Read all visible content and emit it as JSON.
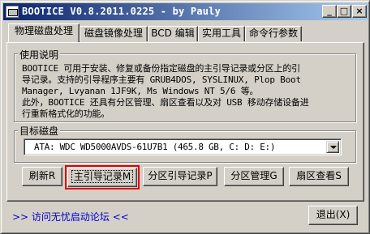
{
  "window": {
    "title": "BOOTICE V0.8.2011.0225 - by Pauly",
    "minimize_glyph": "_",
    "maximize_glyph": "□",
    "close_glyph": "×"
  },
  "tabs": [
    {
      "label": "物理磁盘处理",
      "active": true
    },
    {
      "label": "磁盘镜像处理",
      "active": false
    },
    {
      "label": "BCD 编辑",
      "active": false
    },
    {
      "label": "实用工具",
      "active": false
    },
    {
      "label": "命令行参数",
      "active": false
    }
  ],
  "usage": {
    "legend": "使用说明",
    "text": "BOOTICE 可用于安装、修复或备份指定磁盘的主引导记录或分区上的引\n导记录。支持的引导程序主要有 GRUB4DOS, SYSLINUX, Plop Boot\nManager, Lvyanan 1JF9K, Ms Windows NT 5/6 等。\n此外，BOOTICE 还具有分区管理、扇区查看以及对 USB 移动存储设备进\n行重新格式化的功能。"
  },
  "target_disk": {
    "legend": "目标磁盘",
    "selected": "ATA: WDC WD5000AVDS-61U7B1 (465.8 GB, C: D: E:)"
  },
  "actions": {
    "refresh": "刷新R",
    "mbr": "主引导记录M",
    "pbr": "分区引导记录P",
    "parts": "分区管理G",
    "sector": "扇区查看S"
  },
  "footer": {
    "forum_link": ">> 访问无忧启动论坛 <<",
    "exit": "退出(X)"
  }
}
